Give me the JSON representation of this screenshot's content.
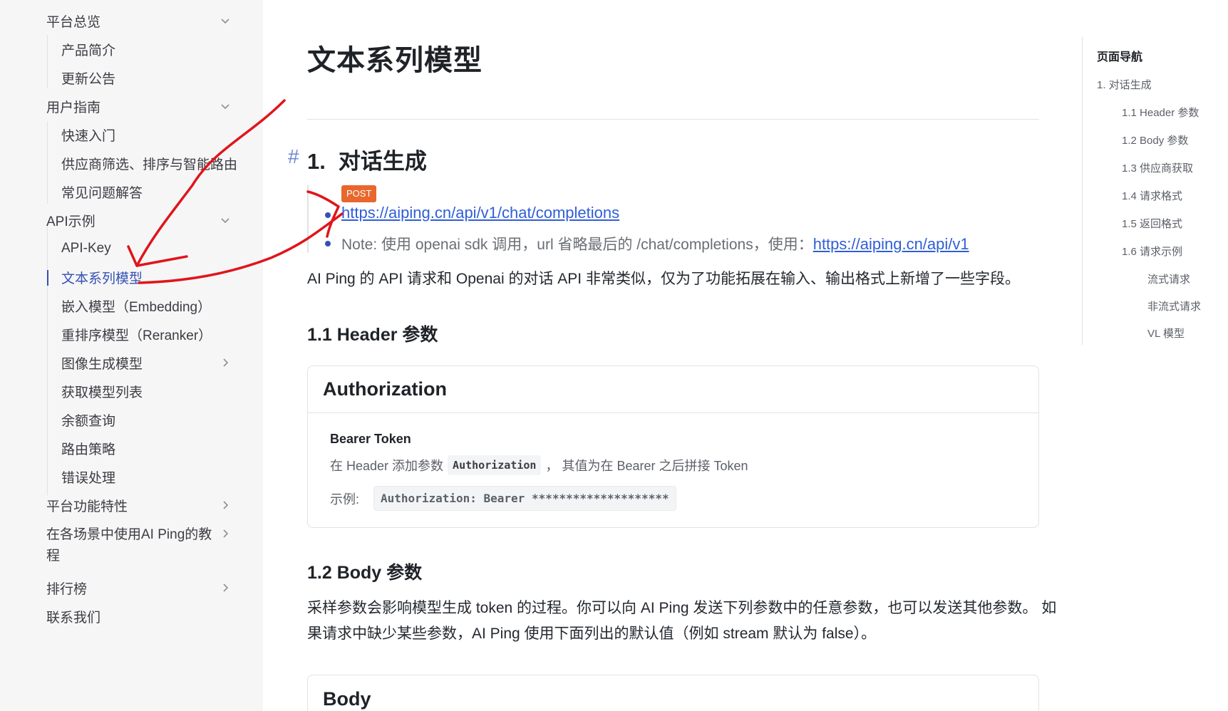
{
  "sidebar": {
    "items": [
      {
        "label": "平台总览",
        "level": 1,
        "chevron": "down"
      },
      {
        "label": "产品简介",
        "level": 2
      },
      {
        "label": "更新公告",
        "level": 2
      },
      {
        "label": "用户指南",
        "level": 1,
        "chevron": "down"
      },
      {
        "label": "快速入门",
        "level": 2
      },
      {
        "label": "供应商筛选、排序与智能路由",
        "level": 2
      },
      {
        "label": "常见问题解答",
        "level": 2
      },
      {
        "label": "API示例",
        "level": 1,
        "chevron": "down"
      },
      {
        "label": "API-Key",
        "level": 2
      },
      {
        "label": "文本系列模型",
        "level": 2,
        "active": true
      },
      {
        "label": "嵌入模型（Embedding）",
        "level": 2
      },
      {
        "label": "重排序模型（Reranker）",
        "level": 2
      },
      {
        "label": "图像生成模型",
        "level": 2,
        "chevron": "right"
      },
      {
        "label": "获取模型列表",
        "level": 2
      },
      {
        "label": "余额查询",
        "level": 2
      },
      {
        "label": "路由策略",
        "level": 2
      },
      {
        "label": "错误处理",
        "level": 2
      },
      {
        "label": "平台功能特性",
        "level": 1,
        "chevron": "right"
      },
      {
        "label": "在各场景中使用AI Ping的教",
        "label_line2": "程",
        "level": 1,
        "chevron": "right"
      },
      {
        "label": "排行榜",
        "level": 1,
        "chevron": "right"
      },
      {
        "label": "联系我们",
        "level": 1
      }
    ]
  },
  "main": {
    "title": "文本系列模型",
    "section1": {
      "anchor": "#",
      "number": "1.",
      "title": "对话生成",
      "method": "POST",
      "endpoint": "https://aiping.cn/api/v1/chat/completions",
      "note_prefix": "Note: 使用 openai sdk 调用，url 省略最后的 /chat/completions，使用：",
      "note_link": "https://aiping.cn/api/v1",
      "intro": "AI Ping 的 API 请求和 Openai 的对话 API 非常类似，仅为了功能拓展在输入、输出格式上新增了一些字段。"
    },
    "section11": {
      "title": "1.1 Header 参数",
      "card_title": "Authorization",
      "sub": "Bearer Token",
      "line1_before": "在 Header 添加参数",
      "line1_code": "Authorization",
      "line1_after": "，  其值为在 Bearer 之后拼接 Token",
      "example_label": "示例:",
      "example_code": "Authorization: Bearer ********************"
    },
    "section12": {
      "title": "1.2 Body 参数",
      "para_line1": "采样参数会影响模型生成 token 的过程。你可以向 AI Ping 发送下列参数中的任意参数，也可以发送其他参数。 如",
      "para_line2": "果请求中缺少某些参数，AI Ping 使用下面列出的默认值（例如 stream 默认为 false）。",
      "card_title": "Body"
    }
  },
  "outline": {
    "title": "页面导航",
    "items": [
      {
        "label": "1. 对话生成",
        "level": 1
      },
      {
        "label": "1.1 Header 参数",
        "level": 2
      },
      {
        "label": "1.2 Body 参数",
        "level": 2
      },
      {
        "label": "1.3 供应商获取",
        "level": 2
      },
      {
        "label": "1.4 请求格式",
        "level": 2
      },
      {
        "label": "1.5 返回格式",
        "level": 2
      },
      {
        "label": "1.6 请求示例",
        "level": 2
      },
      {
        "label": "流式请求",
        "level": 3
      },
      {
        "label": "非流式请求",
        "level": 3
      },
      {
        "label": "VL 模型",
        "level": 3
      }
    ]
  },
  "colors": {
    "accent": "#3451b2",
    "link": "#2f5ed8",
    "post_badge": "#e8672c",
    "annotation": "#e0151b",
    "sidebar_bg": "#f6f6f7"
  }
}
